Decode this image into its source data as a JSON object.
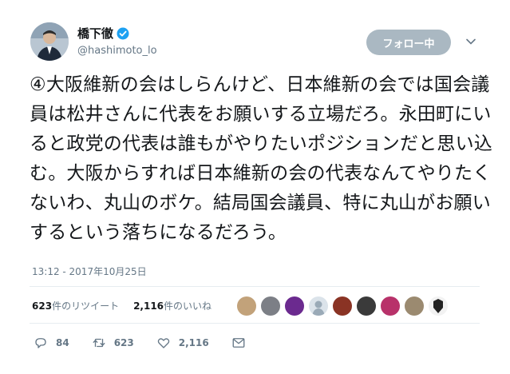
{
  "tweet": {
    "author_name": "橋下徹",
    "handle": "@hashimoto_lo",
    "follow_label": "フォロー中",
    "text": "④大阪維新の会はしらんけど、日本維新の会では国会議員は松井さんに代表をお願いする立場だろ。永田町にいると政党の代表は誰もがやりたいポジションだと思い込む。大阪からすれば日本維新の会の代表なんてやりたくないわ、丸山のボケ。結局国会議員、特に丸山がお願いするという落ちになるだろう。",
    "timestamp": "13:12 - 2017年10月25日"
  },
  "stats": {
    "retweet_count": "623",
    "retweet_label": "件のリツイート",
    "like_count": "2,116",
    "like_label": "件のいいね"
  },
  "likers": [
    "avatar-1",
    "avatar-2",
    "avatar-3",
    "avatar-4",
    "avatar-5",
    "avatar-6",
    "avatar-7",
    "avatar-8",
    "avatar-9"
  ],
  "actions": {
    "reply_count": "84",
    "retweet_count": "623",
    "like_count": "2,116"
  },
  "colors": {
    "verified": "#1da1f2",
    "follow_button": "#aab8c2",
    "muted_text": "#657786"
  }
}
